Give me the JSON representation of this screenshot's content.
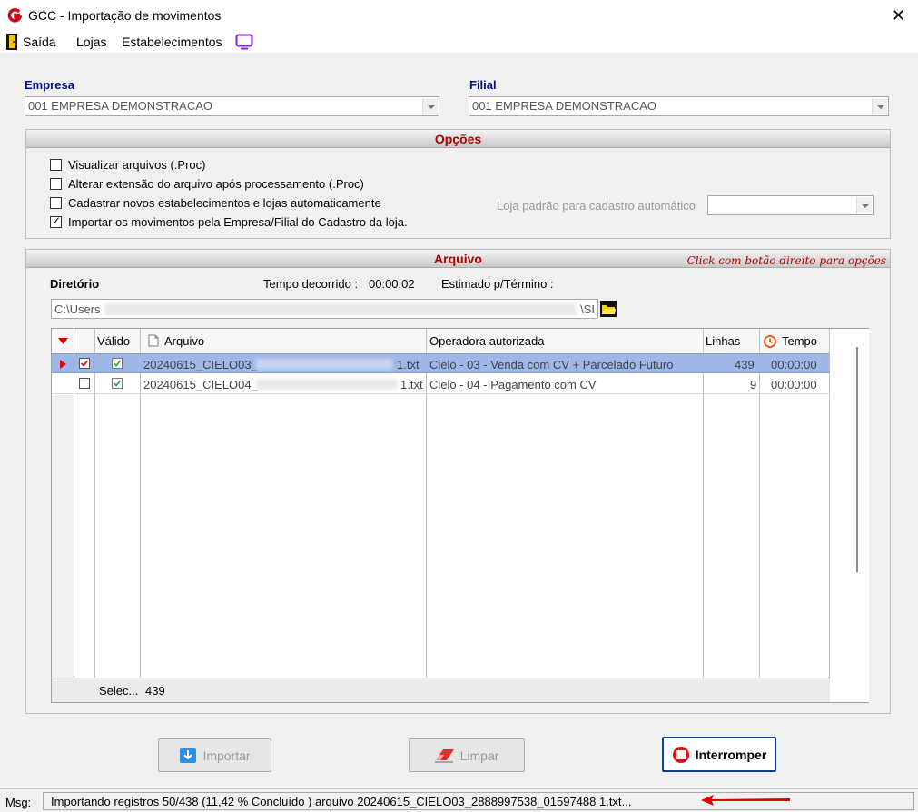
{
  "window": {
    "title": "GCC - Importação de movimentos",
    "close": "✕"
  },
  "menu": {
    "exit": "Saída",
    "stores": "Lojas",
    "establishments": "Estabelecimentos"
  },
  "empresa": {
    "label": "Empresa",
    "value": "001 EMPRESA DEMONSTRACAO"
  },
  "filial": {
    "label": "Filial",
    "value": "001 EMPRESA DEMONSTRACAO"
  },
  "options": {
    "title": "Opções",
    "items": [
      {
        "label": "Visualizar arquivos (.Proc)",
        "checked": false
      },
      {
        "label": "Alterar extensão do arquivo após processamento (.Proc)",
        "checked": false
      },
      {
        "label": "Cadastrar novos estabelecimentos e lojas automaticamente",
        "checked": false
      },
      {
        "label": "Importar os movimentos pela Empresa/Filial do Cadastro da loja.",
        "checked": true
      }
    ],
    "default_store_label": "Loja padrão para cadastro automático",
    "default_store_value": ""
  },
  "arquivo": {
    "title": "Arquivo",
    "hint": "Click com botão direito para opções",
    "dir_label": "Diretório",
    "elapsed_label": "Tempo decorrido :",
    "elapsed_value": "00:00:02",
    "estimated_label": "Estimado p/Término :",
    "path_start": "C:\\Users",
    "path_end": "\\SI"
  },
  "grid": {
    "columns": {
      "valid": "Válido",
      "file": "Arquivo",
      "operator": "Operadora autorizada",
      "lines": "Linhas",
      "time": "Tempo"
    },
    "rows": [
      {
        "file_start": "20240615_CIELO03_",
        "file_end": "1.txt",
        "operator": "Cielo - 03 - Venda com CV + Parcelado Futuro",
        "lines": "439",
        "time": "00:00:00",
        "checked": true,
        "valid": true
      },
      {
        "file_start": "20240615_CIELO04_",
        "file_end": "1.txt",
        "operator": "Cielo - 04 - Pagamento com CV",
        "lines": "9",
        "time": "00:00:00",
        "checked": false,
        "valid": true
      }
    ],
    "footer_label": "Selec...",
    "footer_value": "439"
  },
  "buttons": {
    "import": "Importar",
    "clear": "Limpar",
    "stop": "Interromper"
  },
  "status": {
    "label": "Msg:",
    "message": "Importando registros 50/438 (11,42 % Concluído )  arquivo 20240615_CIELO03_2888997538_01597488 1.txt..."
  },
  "colors": {
    "accent_blue": "#00127f",
    "header_red": "#b00000",
    "selected_row": "#9fb7e8",
    "arrow_red": "#e00000"
  }
}
